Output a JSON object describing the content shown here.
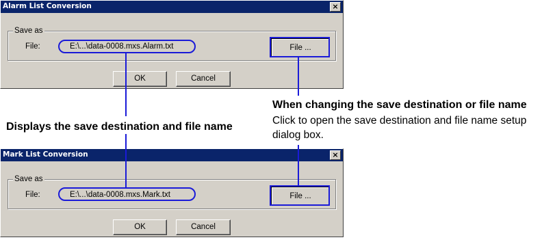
{
  "dialogs": [
    {
      "title": "Alarm List Conversion",
      "close_glyph": "×",
      "group_label": "Save as",
      "file_label": "File:",
      "file_path": "E:\\...\\data-0008.mxs.Alarm.txt",
      "file_button": "File ...",
      "ok_button": "OK",
      "cancel_button": "Cancel"
    },
    {
      "title": "Mark List Conversion",
      "close_glyph": "×",
      "group_label": "Save as",
      "file_label": "File:",
      "file_path": "E:\\...\\data-0008.mxs.Mark.txt",
      "file_button": "File ...",
      "ok_button": "OK",
      "cancel_button": "Cancel"
    }
  ],
  "annotations": {
    "left_caption": "Displays the save destination and file name",
    "right_heading": "When changing the save destination or file name",
    "right_body_line1": "Click to open the save destination and file name setup",
    "right_body_line2": "dialog box."
  },
  "colors": {
    "titlebar": "#0a246a",
    "dialog_face": "#d4d0c8",
    "callout": "#1a1ad8"
  }
}
